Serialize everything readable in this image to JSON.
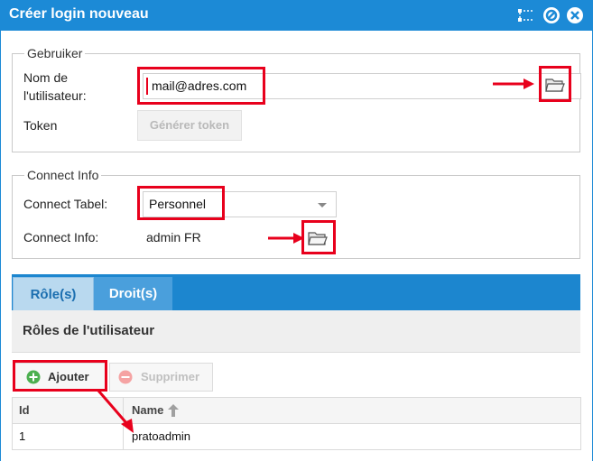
{
  "window": {
    "title": "Créer login nouveau"
  },
  "user_section": {
    "legend": "Gebruiker",
    "username_label": "Nom de l'utilisateur:",
    "username_value": "mail@adres.com",
    "token_label": "Token",
    "generate_token_label": "Générer token"
  },
  "connect_section": {
    "legend": "Connect Info",
    "table_label": "Connect Tabel:",
    "table_value": "Personnel",
    "info_label": "Connect Info:",
    "info_value": "admin FR"
  },
  "tabs": [
    {
      "label": "Rôle(s)",
      "active": true
    },
    {
      "label": "Droit(s)",
      "active": false
    }
  ],
  "roles_panel": {
    "title": "Rôles de l'utilisateur",
    "add_label": "Ajouter",
    "delete_label": "Supprimer",
    "columns": [
      "Id",
      "Name"
    ],
    "rows": [
      {
        "id": "1",
        "name": "pratoadmin"
      }
    ]
  },
  "icons": {
    "collapse": "collapse-icon",
    "settings": "gear-icon",
    "close": "close-icon",
    "browse": "folder-open-icon",
    "add": "plus-circle-icon",
    "remove": "minus-circle-icon",
    "sort": "arrow-up-icon"
  },
  "colors": {
    "accent": "#1c8ad6",
    "highlight": "#e8001c",
    "add_icon": "#4caf50",
    "remove_icon": "#f08080"
  }
}
